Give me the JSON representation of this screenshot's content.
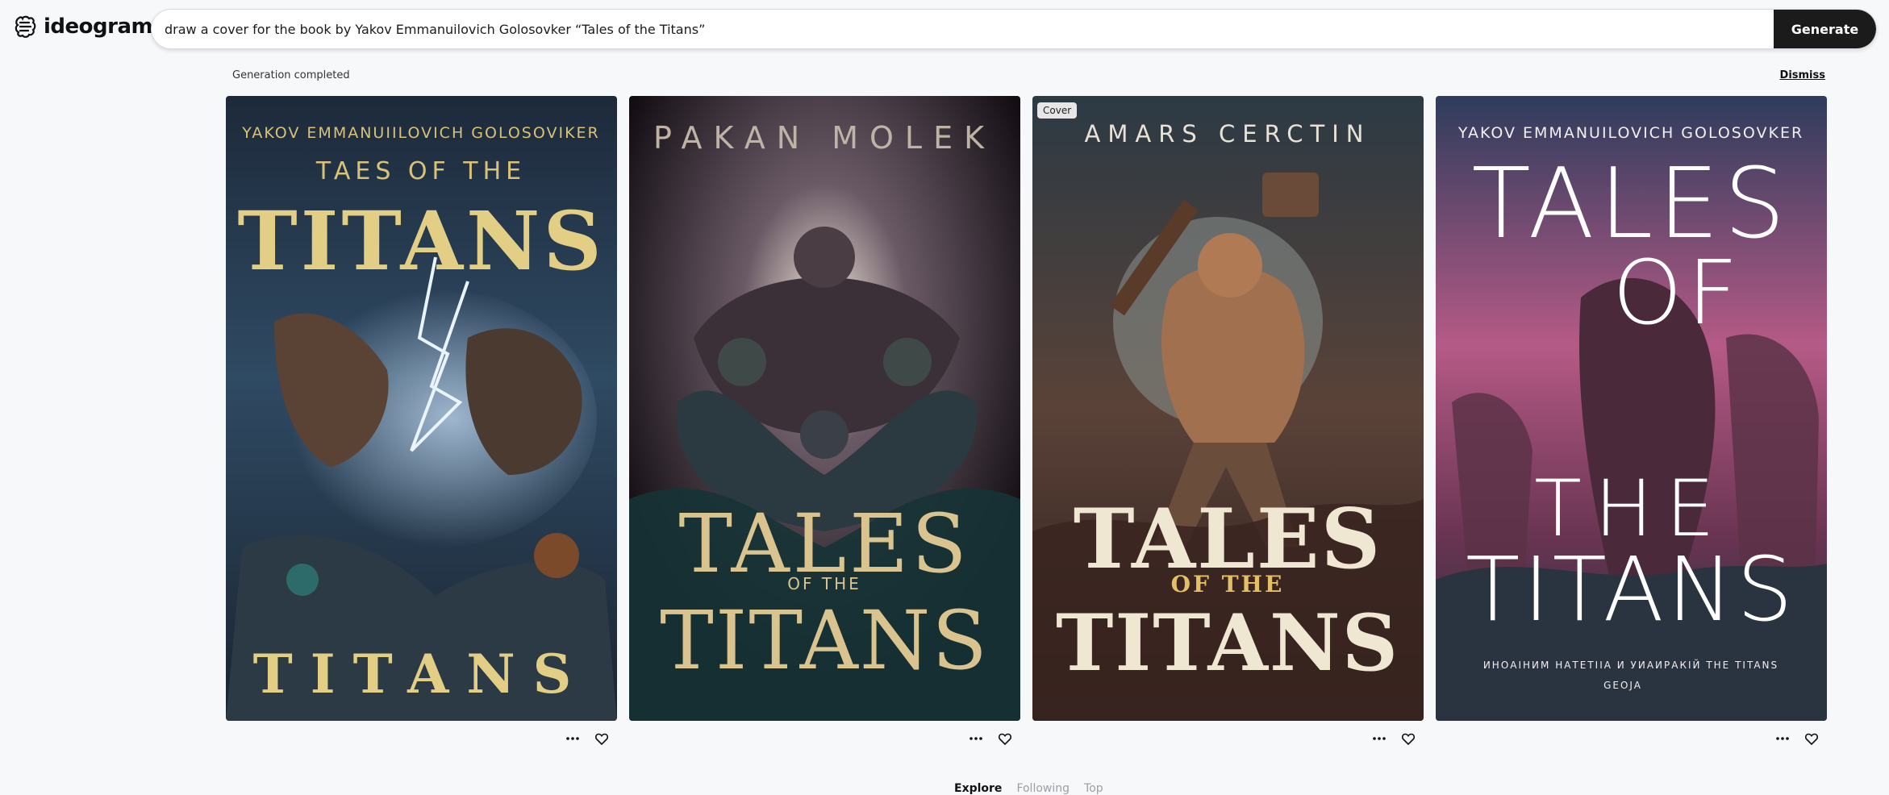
{
  "app": {
    "name": "ideogram",
    "accent": "#1b1b1b",
    "logo_icon": "ideogram-logo-icon"
  },
  "prompt": {
    "value": "draw a cover for the book by Yakov Emmanuilovich Golosovker “Tales of the Titans”",
    "generate_label": "Generate"
  },
  "status": {
    "message": "Generation completed",
    "dismiss_label": "Dismiss"
  },
  "results": [
    {
      "author_line": "YAKOV EMMANUIILOVICH GOLOSOVIKER",
      "title_top": "TAES OF THE",
      "title_main": "TITANS",
      "title_bottom": "TITANS",
      "badge": ""
    },
    {
      "author_line": "PAKAN MOLEK",
      "title_top": "TALES",
      "title_mid": "OF THE",
      "title_main": "TITANS",
      "badge": ""
    },
    {
      "author_line": "AMARS CERCTIN",
      "title_top": "TALES",
      "title_mid": "OF THE",
      "title_main": "TITANS",
      "badge": "Cover"
    },
    {
      "author_line": "YAKOV EMMANUILOVICH GOLOSOVKER",
      "title_top": "TALES",
      "title_mid": "OF",
      "title_the": "THE",
      "title_main": "TITANS",
      "footer_line": "ИНОАІНИМ НАТЕТІІА И УИАИРАКІЙ THE TITANS",
      "footer_sub": "GEOJA"
    }
  ],
  "tabs": [
    {
      "label": "Explore",
      "active": true
    },
    {
      "label": "Following",
      "active": false
    },
    {
      "label": "Top",
      "active": false
    }
  ],
  "icons": {
    "more": "more-horizontal-icon",
    "like": "heart-icon"
  }
}
